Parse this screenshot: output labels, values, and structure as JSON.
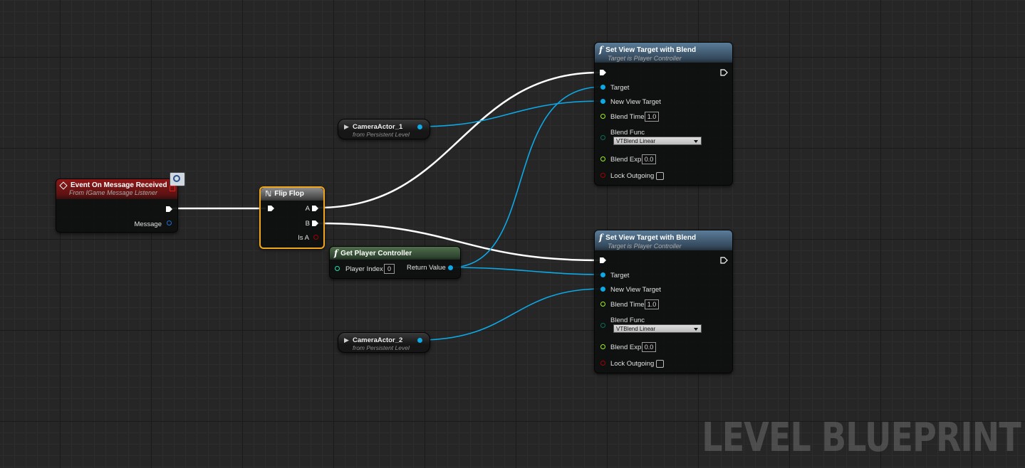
{
  "watermark": "LEVEL BLUEPRINT",
  "colors": {
    "exec_wire": "#ffffff",
    "object_wire": "#0da8e6",
    "float_pin": "#9ef01a",
    "bool_pin": "#a10000",
    "byte_pin": "#0f6b5b",
    "int_pin": "#1fe3b0",
    "struct_pin": "#0b74b8"
  },
  "event_node": {
    "title": "Event On Message Received",
    "subtitle": "From IGame Message Listener",
    "pin_message": "Message",
    "icon": "diamond-event-icon"
  },
  "flipflop_node": {
    "title": "Flip Flop",
    "pin_a": "A",
    "pin_b": "B",
    "pin_is_a": "Is A",
    "icon": "macro-icon"
  },
  "camera1_node": {
    "name": "CameraActor_1",
    "subtitle": "from Persistent Level"
  },
  "camera2_node": {
    "name": "CameraActor_2",
    "subtitle": "from Persistent Level"
  },
  "get_player_controller": {
    "title": "Get Player Controller",
    "pin_player_index": "Player Index",
    "player_index_value": "0",
    "pin_return": "Return Value"
  },
  "set_view_target_1": {
    "title": "Set View Target with Blend",
    "subtitle": "Target is Player Controller",
    "pin_target": "Target",
    "pin_new_view_target": "New View Target",
    "pin_blend_time": "Blend Time",
    "blend_time_value": "1.0",
    "pin_blend_func": "Blend Func",
    "blend_func_value": "VTBlend Linear",
    "pin_blend_exp": "Blend Exp",
    "blend_exp_value": "0.0",
    "pin_lock_outgoing": "Lock Outgoing",
    "lock_outgoing_checked": false
  },
  "set_view_target_2": {
    "title": "Set View Target with Blend",
    "subtitle": "Target is Player Controller",
    "pin_target": "Target",
    "pin_new_view_target": "New View Target",
    "pin_blend_time": "Blend Time",
    "blend_time_value": "1.0",
    "pin_blend_func": "Blend Func",
    "blend_func_value": "VTBlend Linear",
    "pin_blend_exp": "Blend Exp",
    "blend_exp_value": "0.0",
    "pin_lock_outgoing": "Lock Outgoing",
    "lock_outgoing_checked": false
  }
}
